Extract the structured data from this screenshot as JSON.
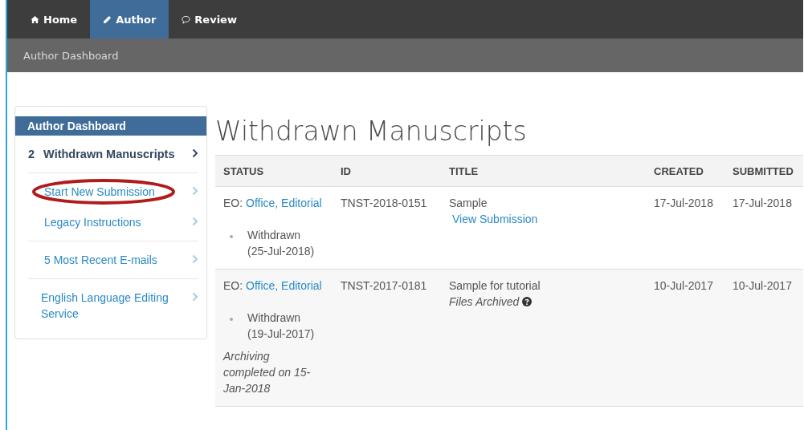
{
  "nav": {
    "tabs": [
      {
        "label": "Home",
        "selected": false
      },
      {
        "label": "Author",
        "selected": true
      },
      {
        "label": "Review",
        "selected": false
      }
    ]
  },
  "breadcrumb": "Author Dashboard",
  "sidebar": {
    "title": "Author Dashboard",
    "sections": [
      {
        "items": [
          {
            "count": "2",
            "label": "Withdrawn Manuscripts",
            "selected": true,
            "circled": false
          }
        ]
      },
      {
        "items": [
          {
            "label": "Start New Submission",
            "selected": false,
            "circled": true
          },
          {
            "label": "Legacy Instructions",
            "selected": false,
            "circled": false
          }
        ]
      },
      {
        "items": [
          {
            "label": "5 Most Recent E-mails",
            "selected": false,
            "circled": false
          }
        ]
      },
      {
        "items": [
          {
            "label": "English Language Editing Service",
            "selected": false,
            "circled": false
          }
        ]
      }
    ]
  },
  "page_title": "Withdrawn Manuscripts",
  "table": {
    "columns": [
      "STATUS",
      "ID",
      "TITLE",
      "CREATED",
      "SUBMITTED"
    ],
    "rows": [
      {
        "status_prefix": "EO:",
        "status_link": "Office, Editorial",
        "status_items": [
          "Withdrawn (25-Jul-2018)"
        ],
        "status_note": null,
        "id": "TNST-2018-0151",
        "title": "Sample",
        "title_link": "View Submission",
        "title_note": null,
        "created": "17-Jul-2018",
        "submitted": "17-Jul-2018"
      },
      {
        "status_prefix": "EO:",
        "status_link": "Office, Editorial",
        "status_items": [
          "Withdrawn (19-Jul-2017)"
        ],
        "status_note": "Archiving completed on 15-Jan-2018",
        "id": "TNST-2017-0181",
        "title": "Sample for tutorial",
        "title_link": null,
        "title_note": "Files Archived",
        "created": "10-Jul-2017",
        "submitted": "10-Jul-2017"
      }
    ]
  }
}
